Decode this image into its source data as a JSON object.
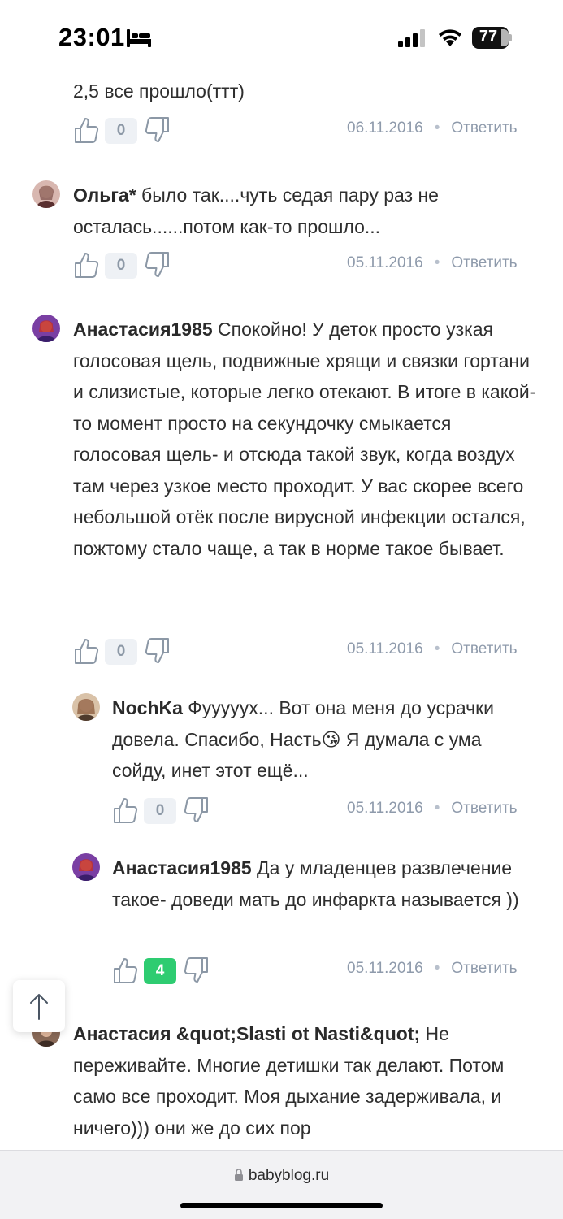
{
  "status": {
    "time": "23:01",
    "battery": "77"
  },
  "comments": [
    {
      "author": "",
      "text": "2,5 все прошло(ттт)",
      "score": "0",
      "date": "06.11.2016",
      "reply": "Ответить"
    },
    {
      "author": "Ольга*",
      "text": " было так....чуть седая пару раз не осталась......потом как-то прошло...",
      "score": "0",
      "date": "05.11.2016",
      "reply": "Ответить"
    },
    {
      "author": "Анастасия1985",
      "text": " Спокойно! У деток просто узкая голосовая щель, подвижные хрящи и связки гортани и слизистые, которые легко отекают. В итоге в какой-то момент просто на секундочку смыкается голосовая щель- и отсюда такой звук, когда воздух там через узкое место проходит. У вас скорее всего небольшой отёк после вирусной инфекции остался, пожтому стало чаще, а так в норме такое бывает.",
      "score": "0",
      "date": "05.11.2016",
      "reply": "Ответить"
    },
    {
      "author": "NochKa",
      "text_before_emoji": " Фууууух... Вот она меня до усрачки довела. Спасибо, Насть",
      "emoji": "😘",
      "text_after_emoji": " Я думала с ума сойду, инет этот ещё...",
      "score": "0",
      "date": "05.11.2016",
      "reply": "Ответить"
    },
    {
      "author": "Анастасия1985",
      "text": " Да у младенцев развлечение такое- доведи мать до инфаркта называется ))",
      "score": "4",
      "date": "05.11.2016",
      "reply": "Ответить"
    },
    {
      "author": "Анастасия &quot;Slasti ot Nasti&quot;",
      "text": " Не переживайте. Многие детишки так делают. Потом само все проходит. Моя дыхание задерживала, и ничего))) они же до сих пор"
    }
  ],
  "browser": {
    "url": "babyblog.ru"
  },
  "colors": {
    "positive_score": "#2ecc71",
    "neutral_score_bg": "#eef1f5",
    "meta_text": "#8e9aab"
  },
  "icons": [
    "thumbs-up-icon",
    "thumbs-down-icon",
    "arrow-up-icon",
    "lock-icon",
    "bed-icon",
    "wifi-icon",
    "signal-icon"
  ]
}
